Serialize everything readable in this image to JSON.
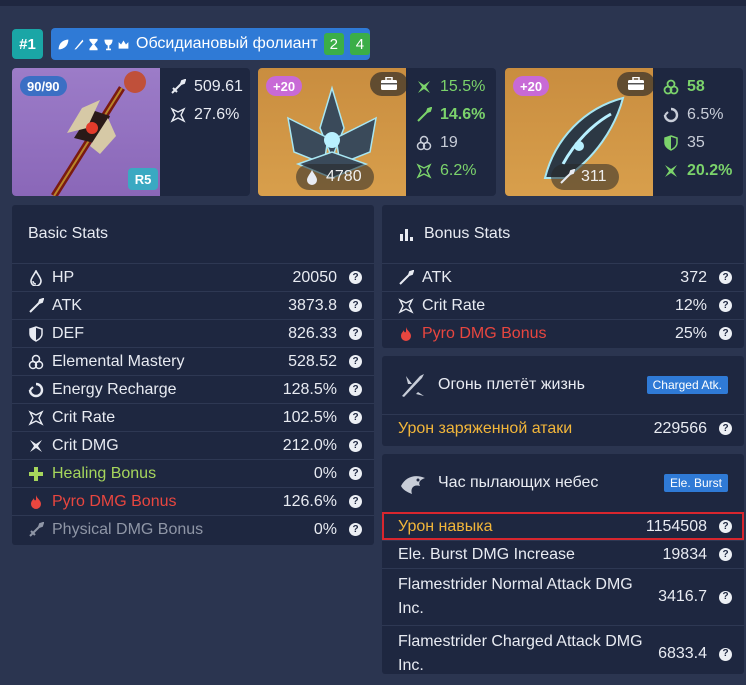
{
  "header": {
    "rank": "#1",
    "set_icons": [
      "leaf-icon",
      "feather-icon",
      "hourglass-icon",
      "goblet-icon",
      "crown-icon"
    ],
    "set_name": "Обсидиановый фолиант",
    "set_counts": [
      "2",
      "4"
    ]
  },
  "weapon": {
    "level": "90/90",
    "refinement": "R5",
    "stats": [
      {
        "icon": "atk-sword-icon",
        "value": "509.61"
      },
      {
        "icon": "crit-rate-icon",
        "value": "27.6%"
      }
    ]
  },
  "artifact1": {
    "level": "+20",
    "main_stat": "4780",
    "main_icon": "hp-drop-icon",
    "substats": [
      {
        "icon": "crit-dmg-icon",
        "value": "15.5%"
      },
      {
        "icon": "atk-sword-icon",
        "value": "14.6%"
      },
      {
        "icon": "elemental-mastery-icon",
        "value": "19"
      },
      {
        "icon": "crit-rate-icon",
        "value": "6.2%"
      }
    ]
  },
  "artifact2": {
    "level": "+20",
    "main_stat": "311",
    "main_icon": "atk-sword-icon",
    "substats": [
      {
        "icon": "elemental-mastery-icon",
        "value": "58"
      },
      {
        "icon": "energy-recharge-icon",
        "value": "6.5%"
      },
      {
        "icon": "def-shield-icon",
        "value": "35"
      },
      {
        "icon": "crit-dmg-icon",
        "value": "20.2%"
      }
    ]
  },
  "basic_stats": {
    "title": "Basic Stats",
    "rows": [
      {
        "label": "HP",
        "value": "20050"
      },
      {
        "label": "ATK",
        "value": "3873.8"
      },
      {
        "label": "DEF",
        "value": "826.33"
      },
      {
        "label": "Elemental Mastery",
        "value": "528.52"
      },
      {
        "label": "Energy Recharge",
        "value": "128.5%"
      },
      {
        "label": "Crit Rate",
        "value": "102.5%"
      },
      {
        "label": "Crit DMG",
        "value": "212.0%"
      },
      {
        "label": "Healing Bonus",
        "value": "0%"
      },
      {
        "label": "Pyro DMG Bonus",
        "value": "126.6%"
      },
      {
        "label": "Physical DMG Bonus",
        "value": "0%"
      }
    ]
  },
  "bonus_stats": {
    "title": "Bonus Stats",
    "rows": [
      {
        "label": "ATK",
        "value": "372"
      },
      {
        "label": "Crit Rate",
        "value": "12%"
      },
      {
        "label": "Pyro DMG Bonus",
        "value": "25%"
      }
    ]
  },
  "talent1": {
    "name": "Огонь плетёт жизнь",
    "tag": "Charged Atk.",
    "rows": [
      {
        "label": "Урон заряженной атаки",
        "value": "229566"
      }
    ]
  },
  "talent2": {
    "name": "Час пылающих небес",
    "tag": "Ele. Burst",
    "rows": [
      {
        "label": "Урон навыка",
        "value": "1154508"
      },
      {
        "label": "Ele. Burst DMG Increase",
        "value": "19834"
      },
      {
        "label": "Flamestrider Normal Attack DMG Inc.",
        "value": "3416.7"
      },
      {
        "label": "Flamestrider Charged Attack DMG Inc.",
        "value": "6833.4"
      }
    ]
  },
  "colors": {
    "background": "#2b3550",
    "panel": "#1e2740",
    "accent_blue": "#2f7ad6",
    "green": "#7bd36b",
    "pyro": "#e8463f",
    "gold": "#f2b63a",
    "highlight": "#d8262e"
  }
}
